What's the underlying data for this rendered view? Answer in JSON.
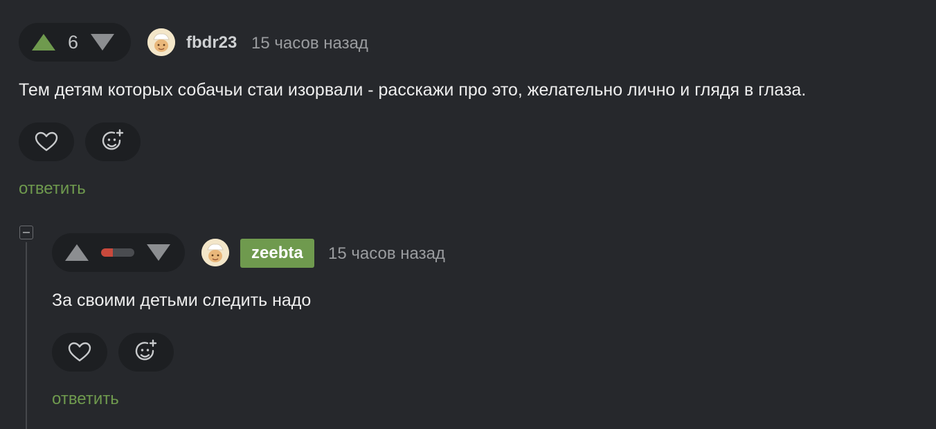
{
  "comments": [
    {
      "author": "fbdr23",
      "time": "15 часов назад",
      "rating": "6",
      "text": "Тем детям которых собачьи стаи изорвали - расскажи про это, желательно лично и глядя в глаза.",
      "reply_label": "ответить"
    },
    {
      "author": "zeebta",
      "time": "15 часов назад",
      "rating_bar_fraction": 0.35,
      "text": "За своими детьми следить надо",
      "reply_label": "ответить"
    }
  ],
  "colors": {
    "accent_green": "#6f9a4e",
    "negative_red": "#c9493c",
    "background": "#26282c"
  },
  "icons": [
    "arrow-up-icon",
    "arrow-down-icon",
    "heart-icon",
    "emoji-add-icon",
    "collapse-icon"
  ]
}
